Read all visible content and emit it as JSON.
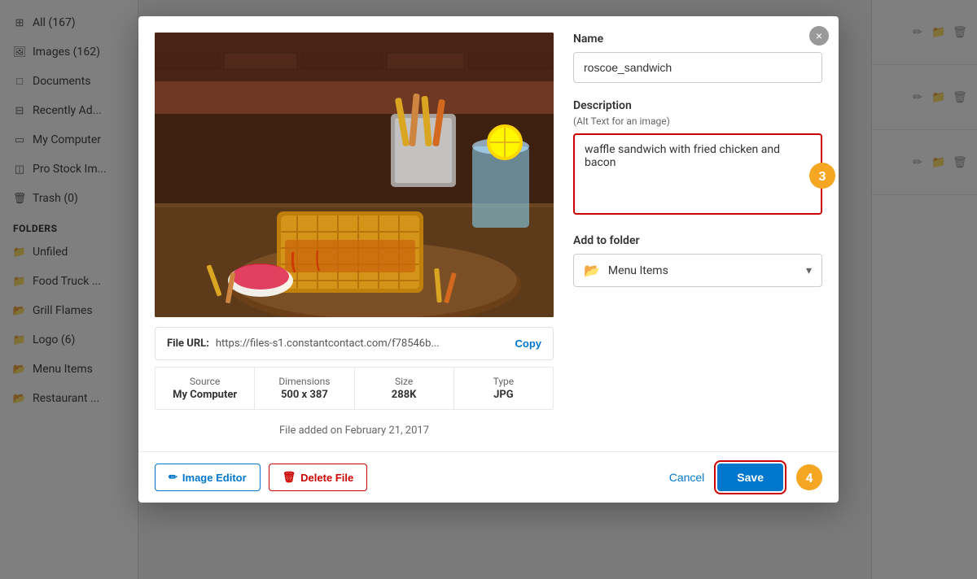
{
  "sidebar": {
    "items": [
      {
        "id": "all",
        "label": "All (167)",
        "icon": "grid"
      },
      {
        "id": "images",
        "label": "Images (162)",
        "icon": "image"
      },
      {
        "id": "documents",
        "label": "Documents",
        "icon": "doc"
      },
      {
        "id": "recently-added",
        "label": "Recently Ad...",
        "icon": "clock"
      },
      {
        "id": "my-computer",
        "label": "My Computer",
        "icon": "monitor"
      },
      {
        "id": "pro-stock",
        "label": "Pro Stock Im...",
        "icon": "photo"
      },
      {
        "id": "trash",
        "label": "Trash (0)",
        "icon": "trash"
      }
    ],
    "folders_label": "Folders",
    "folders": [
      {
        "id": "unfiled",
        "label": "Unfiled",
        "icon": "folder"
      },
      {
        "id": "food-truck",
        "label": "Food Truck ...",
        "icon": "folder"
      },
      {
        "id": "grill-flames",
        "label": "Grill Flames",
        "icon": "folder-filled"
      },
      {
        "id": "logo",
        "label": "Logo (6)",
        "icon": "folder"
      },
      {
        "id": "menu-items",
        "label": "Menu Items",
        "icon": "folder-filled"
      },
      {
        "id": "restaurant",
        "label": "Restaurant ...",
        "icon": "folder-filled"
      }
    ]
  },
  "modal": {
    "close_label": "×",
    "name_label": "Name",
    "name_value": "roscoe_sandwich",
    "description_label": "Description",
    "alt_text_hint": "(Alt Text for an image)",
    "description_value": "waffle sandwich with fried chicken and bacon",
    "folder_label": "Add to folder",
    "folder_selected": "Menu Items",
    "file_url_label": "File URL:",
    "file_url_value": "https://files-s1.constantcontact.com/f78546b...",
    "copy_label": "Copy",
    "meta": {
      "source_label": "Source",
      "source_value": "My Computer",
      "dimensions_label": "Dimensions",
      "dimensions_value": "500 x 387",
      "size_label": "Size",
      "size_value": "288K",
      "type_label": "Type",
      "type_value": "JPG"
    },
    "file_added_text": "File added on February 21, 2017",
    "image_editor_label": "Image Editor",
    "delete_file_label": "Delete File",
    "cancel_label": "Cancel",
    "save_label": "Save",
    "step_3": "3",
    "step_4": "4"
  },
  "colors": {
    "accent": "#0077cc",
    "danger": "#cc0000",
    "badge": "#f5a623"
  }
}
